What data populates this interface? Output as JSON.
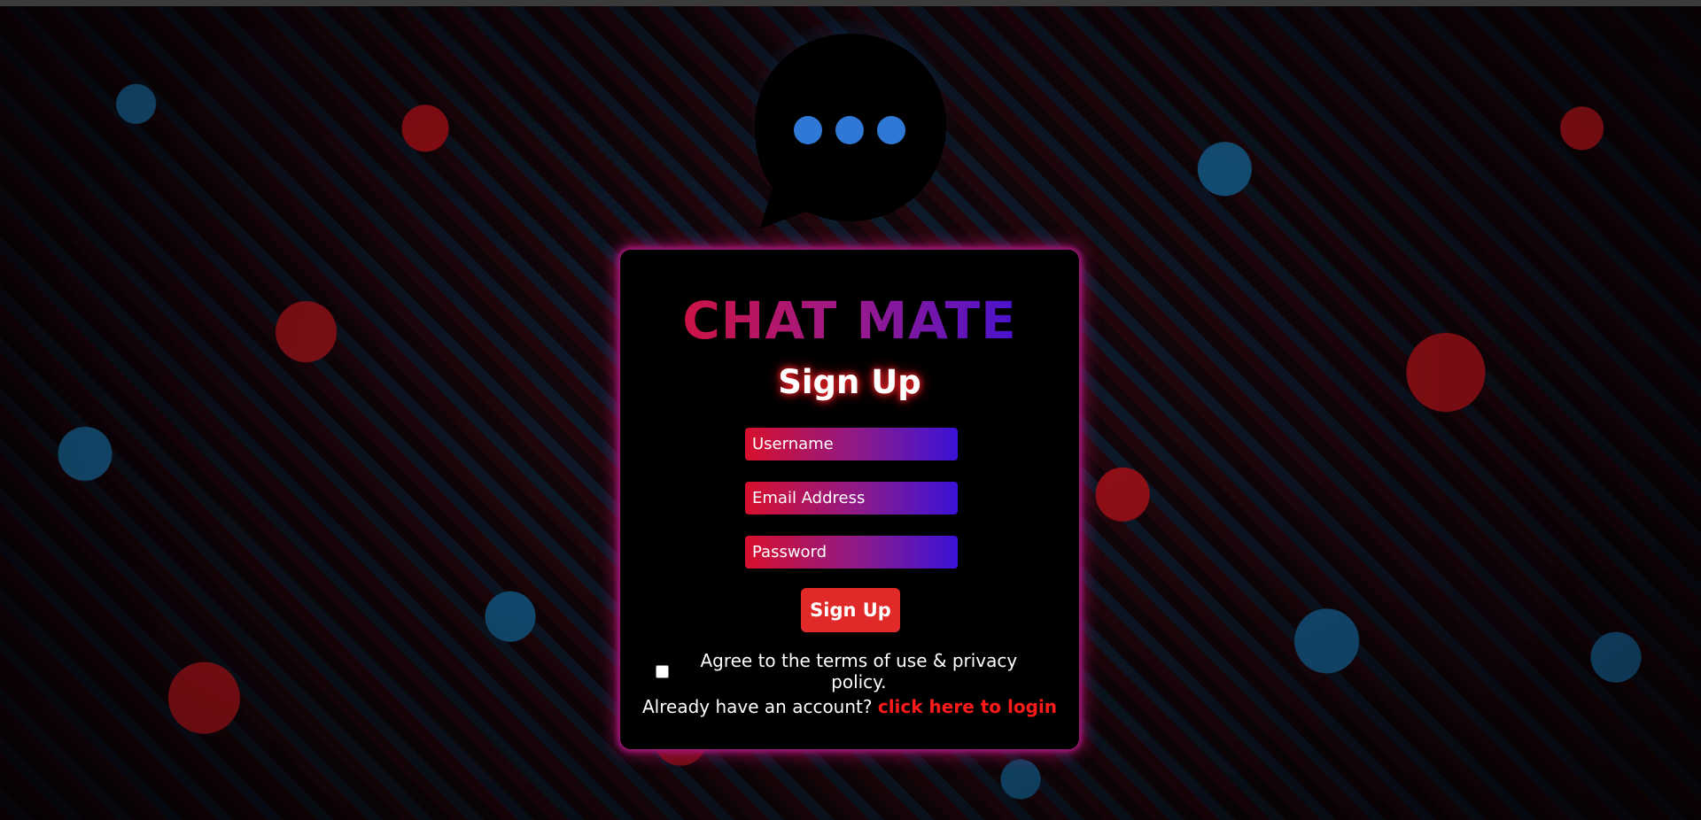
{
  "app": {
    "brand_name": "CHAT MATE",
    "logo_icon": "chat-bubble-dots-icon"
  },
  "form": {
    "title": "Sign Up",
    "username_placeholder": "Username",
    "email_placeholder": "Email Address",
    "password_placeholder": "Password",
    "submit_label": "Sign Up",
    "agree_label": "Agree to the terms of use & privacy policy.",
    "agree_checked": false,
    "login_prompt": "Already have an account?",
    "login_link": "click here to login"
  },
  "colors": {
    "accent_red": "#e02a2a",
    "link_red": "#ff1a1a",
    "gradient_start": "#e0102a",
    "gradient_mid": "#9b1a8a",
    "gradient_end": "#2a10e8",
    "card_glow": "#a0187a",
    "dot_blue": "#2f78d6"
  }
}
